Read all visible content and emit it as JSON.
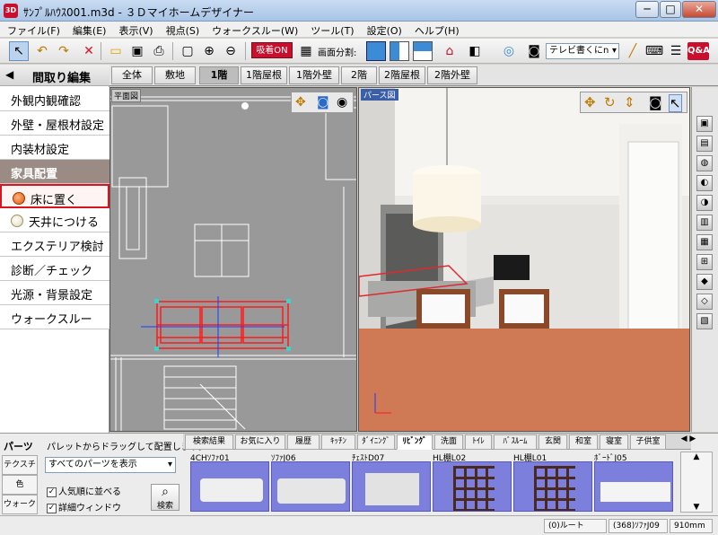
{
  "window": {
    "title": "ｻﾝﾌﾟﾙﾊｳｽ001.m3d - ３Ｄマイホームデザイナー",
    "app_icon": "3D"
  },
  "window_buttons": {
    "minimize": "─",
    "maximize": "□",
    "close": "✕"
  },
  "menu": [
    "ファイル(F)",
    "編集(E)",
    "表示(V)",
    "視点(S)",
    "ウォークスルー(W)",
    "ツール(T)",
    "設定(O)",
    "ヘルプ(H)"
  ],
  "toolbar": {
    "snap_label": "吸着ON",
    "split_label": "画面分割:",
    "view_select": "テレビ書くにn",
    "qa_label": "Q&A"
  },
  "left_panel": {
    "mode_title": "間取り編集",
    "mode_arrow": "◀",
    "items": [
      "外観内観確認",
      "外壁・屋根材設定",
      "内装材設定"
    ],
    "section": "家具配置",
    "radio_floor": "床に置く",
    "radio_ceiling": "天井につける",
    "items2": [
      "エクステリア検討",
      "診断／チェック",
      "光源・背景設定",
      "ウォークスルー"
    ]
  },
  "floor_tabs": [
    "全体",
    "敷地",
    "1階",
    "1階屋根",
    "1階外壁",
    "2階",
    "2階屋根",
    "2階外壁"
  ],
  "plan_view": {
    "label": "平面図"
  },
  "persp_view": {
    "label": "パース図"
  },
  "bottom": {
    "parts_tab": "パーツ",
    "hint": "パレットからドラッグして配置します。",
    "side_tabs": [
      "テクスチャ",
      "色",
      "ウォーク"
    ],
    "filter_select": "すべてのパーツを表示",
    "check_popular": "人気順に並べる",
    "check_detail": "詳細ウィンドウ",
    "search_label": "検索",
    "category_tabs": [
      "検索結果",
      "お気に入り",
      "履歴",
      "ｷｯﾁﾝ",
      "ﾀﾞｲﾆﾝｸﾞ",
      "ﾘﾋﾞﾝｸﾞ",
      "洗面",
      "ﾄｲﾚ",
      "ﾊﾞｽﾙｰﾑ",
      "玄関",
      "和室",
      "寝室",
      "子供室"
    ],
    "category_scroll": "◀ ▶",
    "parts": [
      "4CHｿﾌｧ01",
      "ｿﾌｧJ06",
      "ﾁｪｽﾄD07",
      "HL棚L02",
      "HL棚L01",
      "ﾎﾞｰﾄﾞJ05"
    ]
  },
  "status": {
    "root": "(0)ルート",
    "part": "(368)ｿﾌｧJ09",
    "size": "910mm"
  },
  "colors": {
    "accent": "#c8102e",
    "panel_section": "#9a8b84",
    "palette_bg": "#7c7fdc",
    "floor_orange": "#cf7a55"
  }
}
